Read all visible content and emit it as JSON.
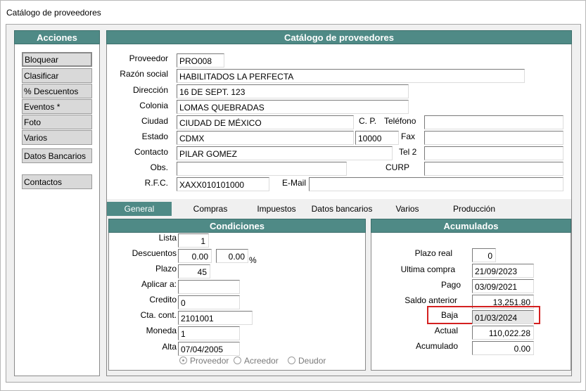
{
  "window": {
    "title": "Catálogo de proveedores"
  },
  "actions": {
    "header": "Acciones",
    "buttons": [
      "Bloquear",
      "Clasificar",
      "% Descuentos",
      "Eventos *",
      "Foto",
      "Varios",
      "Datos Bancarios",
      "Contactos"
    ]
  },
  "catalog": {
    "header": "Catálogo de proveedores",
    "labels": {
      "proveedor": "Proveedor",
      "razon_social": "Razón social",
      "direccion": "Dirección",
      "colonia": "Colonia",
      "ciudad": "Ciudad",
      "cp": "C. P.",
      "telefono": "Teléfono",
      "estado": "Estado",
      "fax": "Fax",
      "contacto": "Contacto",
      "tel2": "Tel 2",
      "obs": "Obs.",
      "curp": "CURP",
      "rfc": "R.F.C.",
      "email": "E-Mail"
    },
    "values": {
      "proveedor": "PRO008",
      "razon_social": "HABILITADOS LA PERFECTA",
      "direccion": "16 DE SEPT. 123",
      "colonia": "LOMAS QUEBRADAS",
      "ciudad": "CIUDAD DE MÉXICO",
      "cp": "10000",
      "telefono": "",
      "estado": "CDMX",
      "fax": "",
      "contacto": "PILAR GOMEZ",
      "tel2": "",
      "obs": "",
      "curp": "",
      "rfc": "XAXX010101000",
      "email": ""
    }
  },
  "tabs": [
    "General",
    "Compras",
    "Impuestos",
    "Datos bancarios",
    "Varios",
    "Producción"
  ],
  "condiciones": {
    "header": "Condiciones",
    "labels": {
      "lista": "Lista",
      "descuentos": "Descuentos",
      "pct": "%",
      "plazo": "Plazo",
      "aplicar": "Aplicar a:",
      "credito": "Credito",
      "cta": "Cta. cont.",
      "moneda": "Moneda",
      "alta": "Alta"
    },
    "values": {
      "lista": "1",
      "desc1": "0.00",
      "desc2": "0.00",
      "plazo": "45",
      "aplicar": "",
      "credito": "0",
      "cta": "2101001",
      "moneda": "1",
      "alta": "07/04/2005"
    },
    "radios": [
      "Proveedor",
      "Acreedor",
      "Deudor"
    ],
    "radio_selected": "Proveedor"
  },
  "acumulados": {
    "header": "Acumulados",
    "labels": {
      "plazo_real": "Plazo real",
      "ultima_compra": "Ultima compra",
      "pago": "Pago",
      "saldo_anterior": "Saldo anterior",
      "baja": "Baja",
      "actual": "Actual",
      "acumulado": "Acumulado"
    },
    "values": {
      "plazo_real": "0",
      "ultima_compra": "21/09/2023",
      "pago": "03/09/2021",
      "saldo_anterior": "13,251.80",
      "baja": "01/03/2024",
      "actual": "110,022.28",
      "acumulado": "0.00"
    }
  },
  "colors": {
    "header_teal": "#4f8a86",
    "highlight_red": "#d42020"
  }
}
